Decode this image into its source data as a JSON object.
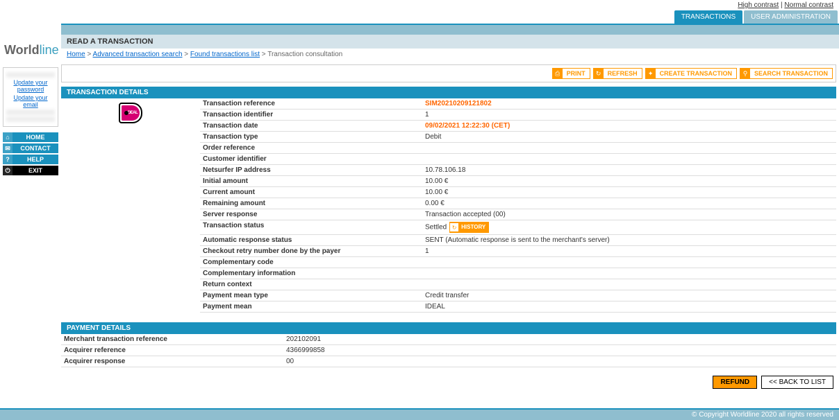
{
  "top_links": {
    "high_contrast": "High contrast",
    "normal_contrast": "Normal contrast"
  },
  "logo": {
    "part1": "World",
    "part2": "line"
  },
  "tabs": {
    "transactions": "TRANSACTIONS",
    "user_admin": "USER ADMINISTRATION"
  },
  "page_title": "READ A TRANSACTION",
  "breadcrumb": {
    "home": "Home",
    "search": "Advanced transaction search",
    "found": "Found transactions list",
    "current": "Transaction consultation",
    "sep": ">"
  },
  "sidebar": {
    "update_pw": "Update your password",
    "update_email": "Update your email",
    "items": [
      {
        "icon": "⌂",
        "label": "HOME"
      },
      {
        "icon": "✉",
        "label": "CONTACT"
      },
      {
        "icon": "?",
        "label": "HELP"
      },
      {
        "icon": "⏻",
        "label": "EXIT"
      }
    ]
  },
  "actions": {
    "print": "PRINT",
    "refresh": "REFRESH",
    "create": "CREATE TRANSACTION",
    "search": "SEARCH TRANSACTION"
  },
  "section_tx": "TRANSACTION DETAILS",
  "section_pay": "PAYMENT DETAILS",
  "ideal": "DEAL",
  "tx": [
    {
      "label": "Transaction reference",
      "value": "SIM20210209121802",
      "hl": true
    },
    {
      "label": "Transaction identifier",
      "value": "1"
    },
    {
      "label": "Transaction date",
      "value": "09/02/2021 12:22:30 (CET)",
      "hl": true
    },
    {
      "label": "Transaction type",
      "value": "Debit"
    },
    {
      "label": "Order reference",
      "value": ""
    },
    {
      "label": "Customer identifier",
      "value": ""
    },
    {
      "label": "Netsurfer IP address",
      "value": "10.78.106.18"
    },
    {
      "label": "Initial amount",
      "value": "10.00 €"
    },
    {
      "label": "Current amount",
      "value": "10.00 €"
    },
    {
      "label": "Remaining amount",
      "value": "0.00 €"
    },
    {
      "label": "Server response",
      "value": "Transaction accepted (00)"
    },
    {
      "label": "Transaction status",
      "value": "Settled",
      "history": true
    },
    {
      "label": "Automatic response status",
      "value": "SENT (Automatic response is sent to the merchant's server)"
    },
    {
      "label": "Checkout retry number done by the payer",
      "value": "1"
    },
    {
      "label": "Complementary code",
      "value": ""
    },
    {
      "label": "Complementary information",
      "value": ""
    },
    {
      "label": "Return context",
      "value": ""
    },
    {
      "label": "Payment mean type",
      "value": "Credit transfer"
    },
    {
      "label": "Payment mean",
      "value": "IDEAL"
    }
  ],
  "pay": [
    {
      "label": "Merchant transaction reference",
      "value": "202102091"
    },
    {
      "label": "Acquirer reference",
      "value": "4366999858"
    },
    {
      "label": "Acquirer response",
      "value": "00"
    }
  ],
  "history_label": "HISTORY",
  "bottom": {
    "refund": "REFUND",
    "back": "<< BACK TO LIST"
  },
  "footer": "© Copyright Worldline 2020 all rights reserved"
}
